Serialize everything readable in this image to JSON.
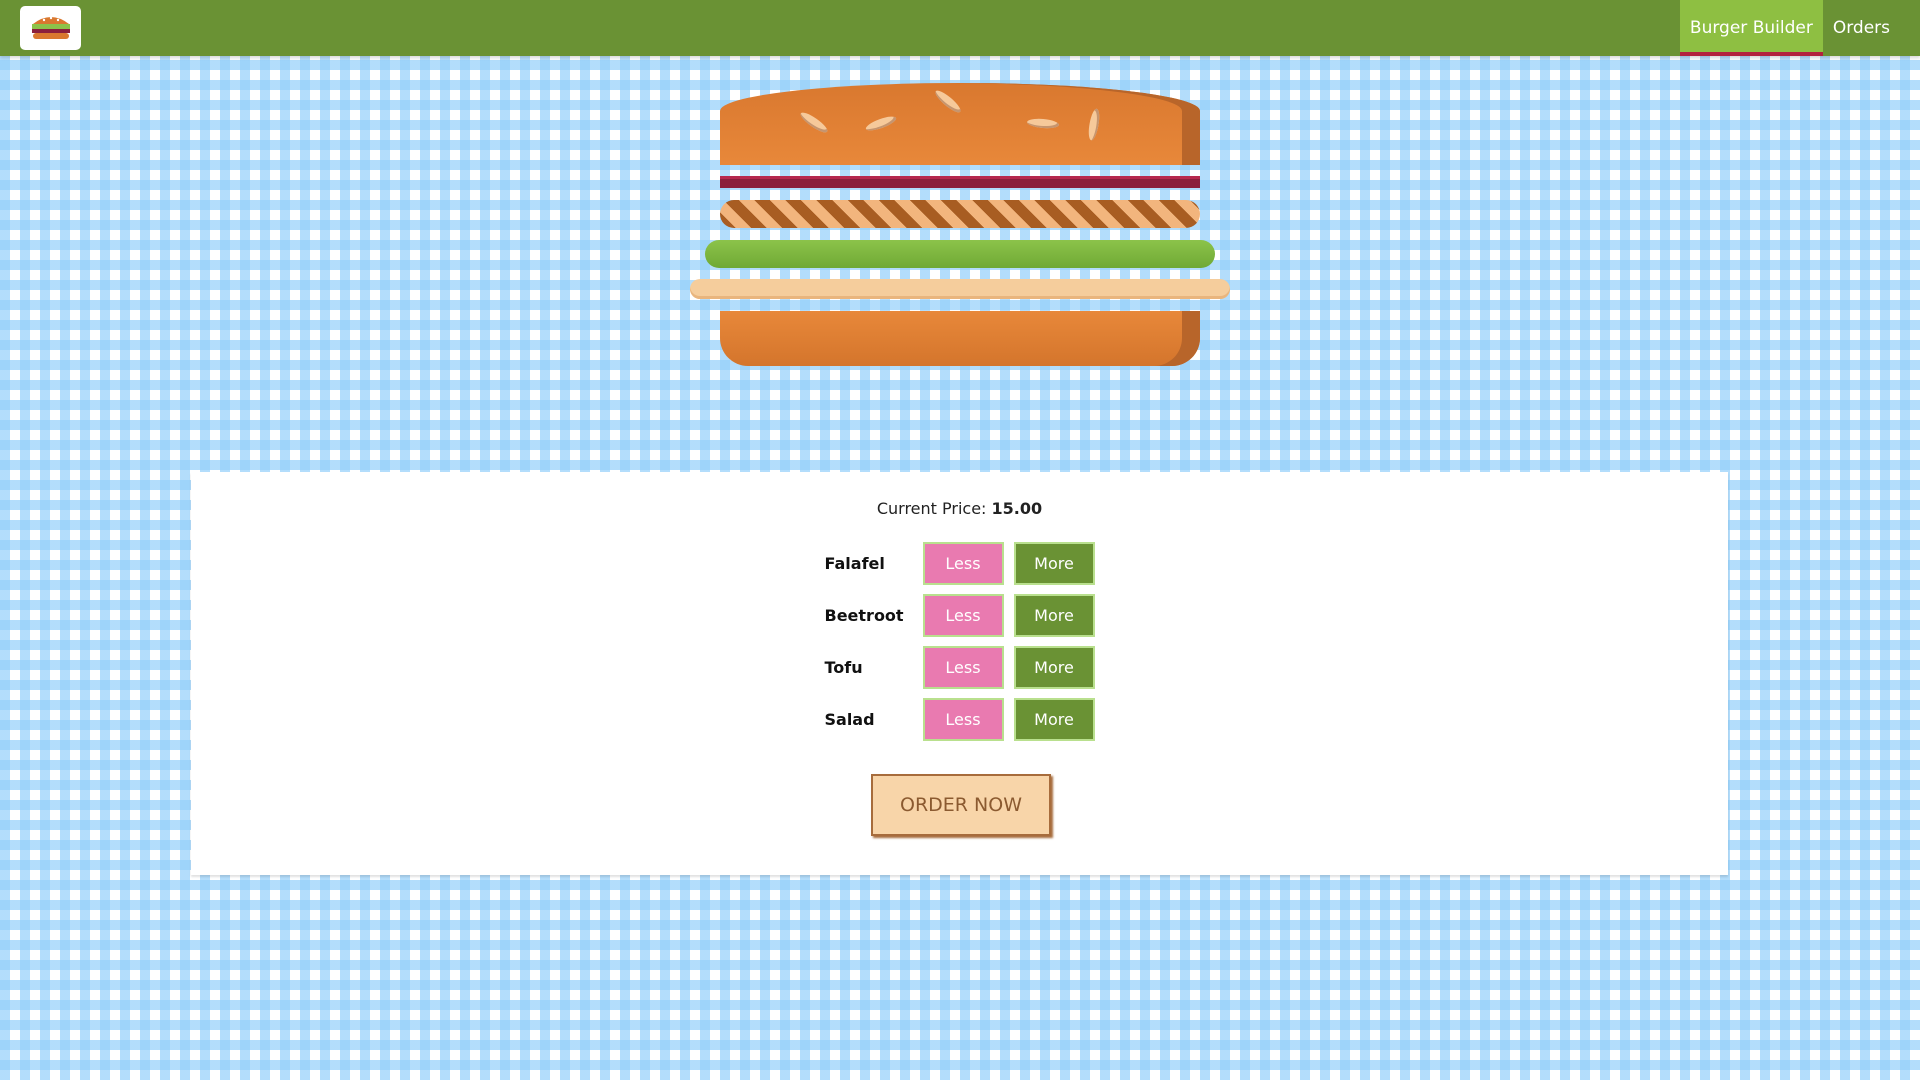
{
  "app": {
    "logo_icon": "burger-logo-icon"
  },
  "nav": {
    "items": [
      {
        "label": "Burger Builder",
        "active": true
      },
      {
        "label": "Orders",
        "active": false
      }
    ]
  },
  "burger": {
    "layers": [
      "bread-top",
      "beetroot",
      "falafel",
      "salad",
      "tofu",
      "bread-bottom"
    ]
  },
  "controls": {
    "price_label": "Current Price:",
    "price_value": "15.00",
    "ingredients": [
      {
        "label": "Falafel",
        "less": "Less",
        "more": "More"
      },
      {
        "label": "Beetroot",
        "less": "Less",
        "more": "More"
      },
      {
        "label": "Tofu",
        "less": "Less",
        "more": "More"
      },
      {
        "label": "Salad",
        "less": "Less",
        "more": "More"
      }
    ],
    "order_label": "ORDER NOW"
  },
  "colors": {
    "toolbar": "#6a9234",
    "active_nav": "#8ebf42",
    "less_button": "#e97ab0",
    "more_button": "#6a9234",
    "order_button": "#f8d5a9"
  }
}
